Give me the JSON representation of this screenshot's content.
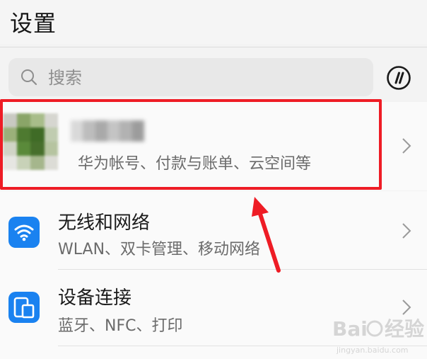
{
  "header": {
    "title": "设置"
  },
  "search": {
    "placeholder": "搜索"
  },
  "account": {
    "subtitle": "华为帐号、付款与账单、云空间等"
  },
  "rows": [
    {
      "title": "无线和网络",
      "subtitle": "WLAN、双卡管理、移动网络",
      "icon": "wifi-icon"
    },
    {
      "title": "设备连接",
      "subtitle": "蓝牙、NFC、打印",
      "icon": "device-connection-icon"
    }
  ],
  "watermark": {
    "brand": "Bai",
    "brand2": "经验",
    "url": "jingyan.baidu.com"
  },
  "colors": {
    "accent": "#1a82f0",
    "highlight": "#ee1c25"
  }
}
